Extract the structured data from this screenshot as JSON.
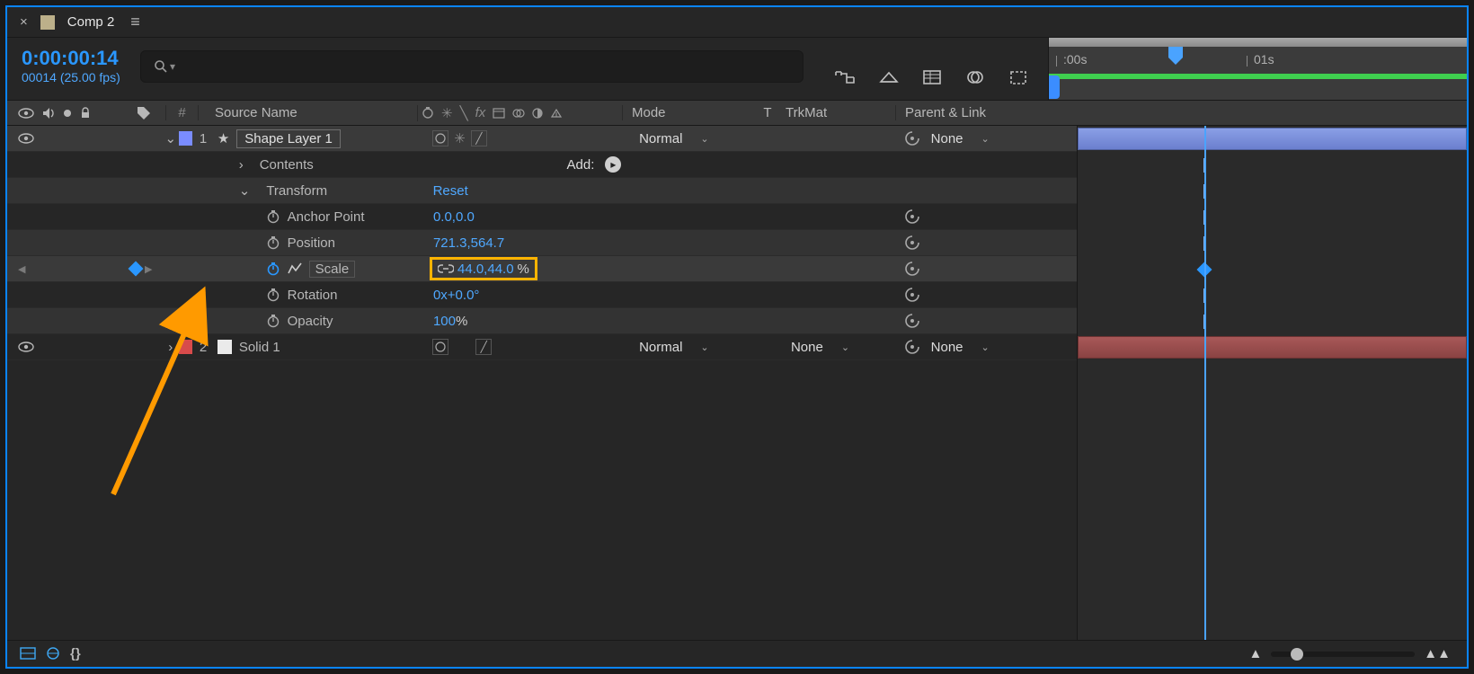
{
  "tab": {
    "close": "×",
    "name": "Comp 2",
    "menu": "≡"
  },
  "time": {
    "code": "0:00:00:14",
    "frames": "00014 (25.00 fps)"
  },
  "search": {
    "placeholder": ""
  },
  "ruler": {
    "t0": ":00s",
    "t1": "01s"
  },
  "columns": {
    "num": "#",
    "source": "Source Name",
    "mode": "Mode",
    "t": "T",
    "trk": "TrkMat",
    "parent": "Parent & Link"
  },
  "layers": [
    {
      "num": "1",
      "name": "Shape Layer 1",
      "mode": "Normal",
      "parent": "None"
    },
    {
      "num": "2",
      "name": "Solid 1",
      "mode": "Normal",
      "trk": "None",
      "parent": "None"
    }
  ],
  "groups": {
    "contents": "Contents",
    "add": "Add:",
    "transform": "Transform",
    "reset": "Reset"
  },
  "props": {
    "anchor": {
      "label": "Anchor Point",
      "value": "0.0,0.0"
    },
    "position": {
      "label": "Position",
      "value": "721.3,564.7"
    },
    "scale": {
      "label": "Scale",
      "value": "44.0,44.0",
      "unit": "%"
    },
    "rotation": {
      "label": "Rotation",
      "value_x": "0x",
      "value_deg": "+0.0°"
    },
    "opacity": {
      "label": "Opacity",
      "value": "100",
      "unit": "%"
    }
  }
}
